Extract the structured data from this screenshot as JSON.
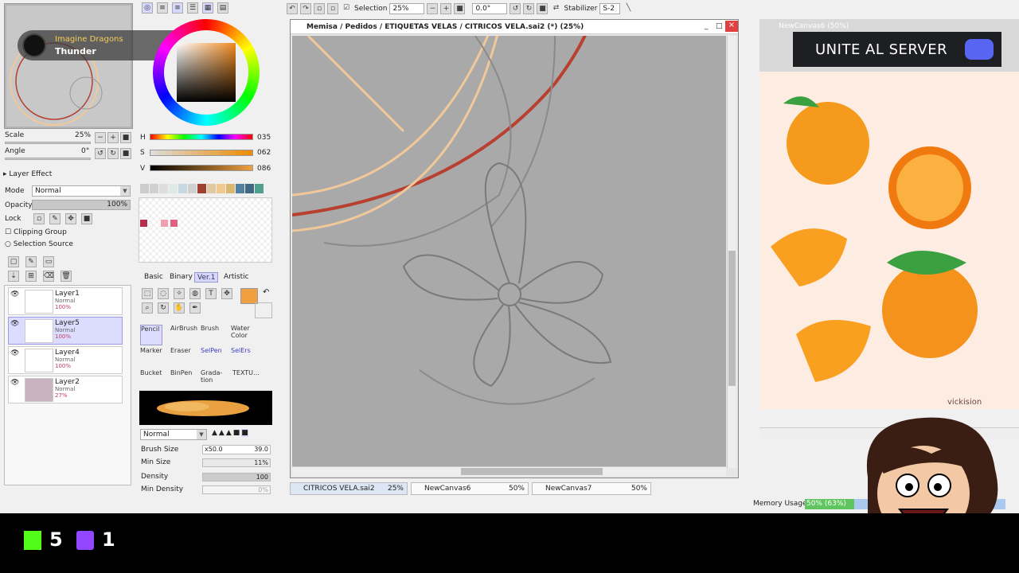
{
  "navigator": {
    "scale_label": "Scale",
    "scale_value": "25%",
    "angle_label": "Angle",
    "angle_value": "0°"
  },
  "layer_effect": {
    "title": "Layer Effect",
    "mode_label": "Mode",
    "mode_value": "Normal",
    "opacity_label": "Opacity",
    "opacity_value": "100%",
    "lock_label": "Lock",
    "clipping_label": "Clipping Group",
    "selection_source_label": "Selection Source"
  },
  "layers": [
    {
      "name": "Layer1",
      "mode": "Normal",
      "opacity": "100%",
      "selected": false
    },
    {
      "name": "Layer5",
      "mode": "Normal",
      "opacity": "100%",
      "selected": true
    },
    {
      "name": "Layer4",
      "mode": "Normal",
      "opacity": "100%",
      "selected": false
    },
    {
      "name": "Layer2",
      "mode": "Normal",
      "opacity": "27%",
      "selected": false
    }
  ],
  "color": {
    "h_label": "H",
    "h_value": "035",
    "s_label": "S",
    "s_value": "062",
    "v_label": "V",
    "v_value": "086",
    "primary": "#f0a040",
    "palette": [
      "#b83050",
      "#f0a0b0",
      "#e06080"
    ]
  },
  "tool_tabs": [
    "Basic",
    "Binary",
    "Ver.1",
    "Artistic"
  ],
  "brushes": [
    {
      "label": "Pencil",
      "selected": true
    },
    {
      "label": "AirBrush",
      "selected": false
    },
    {
      "label": "Brush",
      "selected": false
    },
    {
      "label": "Water Color",
      "selected": false
    },
    {
      "label": "Marker",
      "selected": false
    },
    {
      "label": "Eraser",
      "selected": false
    },
    {
      "label": "SelPen",
      "selected": false
    },
    {
      "label": "SelErs",
      "selected": false
    },
    {
      "label": "Bucket",
      "selected": false
    },
    {
      "label": "BinPen",
      "selected": false
    },
    {
      "label": "Grada-tion",
      "selected": false
    },
    {
      "label": "TEXTU...",
      "selected": false
    }
  ],
  "brush_props": {
    "blend_mode": "Normal",
    "size_label": "Brush Size",
    "size_multiplier": "x50.0",
    "size_value": "39.0",
    "min_size_label": "Min Size",
    "min_size_value": "11%",
    "density_label": "Density",
    "density_value": "100",
    "min_density_label": "Min Density",
    "min_density_value": "0%"
  },
  "toolbar": {
    "selection_label": "Selection",
    "zoom_value": "25%",
    "rotation_value": "0.0°",
    "stabilizer_label": "Stabilizer",
    "stabilizer_value": "S-2"
  },
  "canvas_window": {
    "title": "Memisa / Pedidos / ETIQUETAS VELAS / CITRICOS VELA.sai2 (*) (25%)"
  },
  "doc_tabs": [
    {
      "name": "CITRICOS VELA.sai2",
      "zoom": "25%",
      "active": true
    },
    {
      "name": "NewCanvas6",
      "zoom": "50%",
      "active": false
    },
    {
      "name": "NewCanvas7",
      "zoom": "50%",
      "active": false
    }
  ],
  "right_panel": {
    "tab_title": "NewCanvas6 (50%)",
    "signature": "vickision"
  },
  "overlays": {
    "music_artist": "Imagine Dragons",
    "music_song": "Thunder",
    "banner_text": "UNITE AL SERVER",
    "kick_count": "5",
    "twitch_count": "1"
  },
  "memory": {
    "label": "Memory Usage",
    "value": "50% (63%)"
  }
}
